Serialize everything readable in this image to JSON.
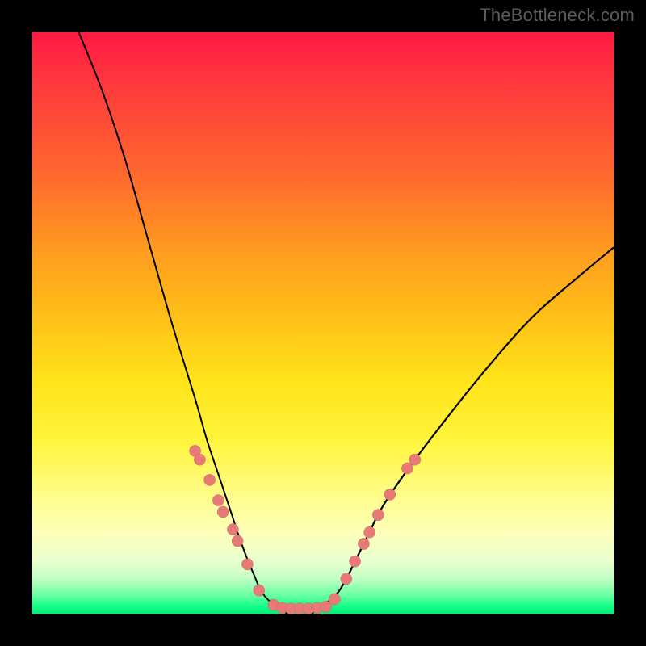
{
  "watermark": "TheBottleneck.com",
  "colors": {
    "frame": "#000000",
    "gradient_top": "#ff1a43",
    "gradient_mid": "#ffe31a",
    "gradient_bottom": "#00ef79",
    "curve": "#000000",
    "dots": "#e77a77"
  },
  "chart_data": {
    "type": "line",
    "title": "",
    "xlabel": "",
    "ylabel": "",
    "xlim": [
      0,
      100
    ],
    "ylim": [
      0,
      100
    ],
    "notes": "Two overlapping bottleneck curves on a vertical heat gradient (red=high bottleneck at top, green=low at bottom). Left curve falls steeply from top-left; right curve rises toward upper-right. Trough near x≈45 at y≈0. Salmon dots cluster along both curve flanks near the trough (y ≲ 28).",
    "series": [
      {
        "name": "left_curve",
        "x": [
          8,
          12,
          16,
          20,
          24,
          28,
          30,
          32,
          34,
          36,
          38,
          40,
          44,
          48
        ],
        "y": [
          100,
          90,
          78,
          64,
          50,
          37,
          30,
          24,
          18,
          12,
          7,
          3,
          0,
          0
        ]
      },
      {
        "name": "right_curve",
        "x": [
          48,
          52,
          54,
          56,
          58,
          60,
          64,
          70,
          78,
          86,
          94,
          100
        ],
        "y": [
          0,
          3,
          6,
          10,
          14,
          18,
          24,
          32,
          42,
          51,
          58,
          63
        ]
      }
    ],
    "scatter": [
      {
        "name": "dots_left",
        "points": [
          {
            "x": 28.0,
            "y": 28.0
          },
          {
            "x": 28.8,
            "y": 26.5
          },
          {
            "x": 30.5,
            "y": 23.0
          },
          {
            "x": 32.0,
            "y": 19.5
          },
          {
            "x": 32.8,
            "y": 17.5
          },
          {
            "x": 34.5,
            "y": 14.5
          },
          {
            "x": 35.3,
            "y": 12.5
          },
          {
            "x": 37.0,
            "y": 8.5
          },
          {
            "x": 39.0,
            "y": 4.0
          }
        ]
      },
      {
        "name": "dots_right",
        "points": [
          {
            "x": 54.0,
            "y": 6.0
          },
          {
            "x": 55.5,
            "y": 9.0
          },
          {
            "x": 57.0,
            "y": 12.0
          },
          {
            "x": 58.0,
            "y": 14.0
          },
          {
            "x": 59.5,
            "y": 17.0
          },
          {
            "x": 61.5,
            "y": 20.5
          },
          {
            "x": 64.5,
            "y": 25.0
          },
          {
            "x": 65.8,
            "y": 26.5
          }
        ]
      },
      {
        "name": "dots_trough",
        "points": [
          {
            "x": 41.5,
            "y": 1.5
          },
          {
            "x": 43.0,
            "y": 1.0
          },
          {
            "x": 44.5,
            "y": 0.9
          },
          {
            "x": 46.0,
            "y": 0.9
          },
          {
            "x": 47.5,
            "y": 0.9
          },
          {
            "x": 49.0,
            "y": 1.0
          },
          {
            "x": 50.5,
            "y": 1.2
          },
          {
            "x": 52.0,
            "y": 2.5
          }
        ]
      }
    ]
  }
}
